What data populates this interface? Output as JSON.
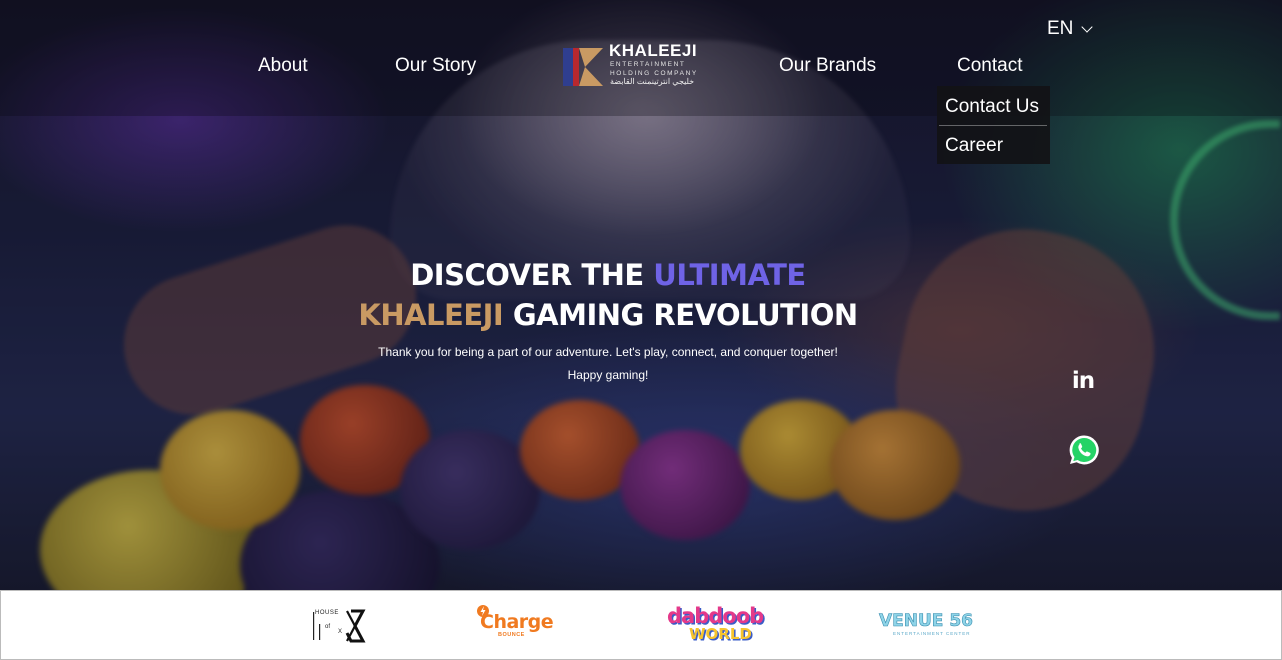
{
  "header": {
    "language": "EN",
    "nav": {
      "about": "About",
      "our_story": "Our Story",
      "our_brands": "Our Brands",
      "contact": "Contact"
    },
    "logo": {
      "title": "KHALEEJI",
      "subtitle_line1": "ENTERTAINMENT",
      "subtitle_line2": "HOLDING COMPANY",
      "arabic": "خليجي انترتينمنت القابضة"
    },
    "contact_dropdown": [
      "Contact Us",
      "Career"
    ]
  },
  "hero": {
    "headline_part1": "DISCOVER THE",
    "headline_accent": "ULTIMATE",
    "headline_gold": "KHALEEJI",
    "headline_part2": "GAMING REVOLUTION",
    "subtext_line1": "Thank you for being a part of our adventure. Let's play, connect, and conquer together!",
    "subtext_line2": "Happy gaming!"
  },
  "social": {
    "linkedin_icon": "linkedin-icon",
    "linkedin_text": "in",
    "whatsapp_icon": "whatsapp-icon"
  },
  "footer_brands": [
    {
      "name": "House of X",
      "lines": [
        "HOUSE",
        "of",
        "X"
      ]
    },
    {
      "name": "Charge Bounce",
      "text": "Charge",
      "sub": "BOUNCE"
    },
    {
      "name": "dabdoob World",
      "text_top": "dabdoob",
      "text_bottom": "WORLD"
    },
    {
      "name": "Venue 56",
      "text": "VENUE 56",
      "sub": "ENTERTAINMENT CENTER"
    }
  ],
  "colors": {
    "accent_purple": "#6f63e6",
    "accent_gold": "#c99a63",
    "dropdown_bg": "#121216",
    "whatsapp_green": "#25d366"
  }
}
